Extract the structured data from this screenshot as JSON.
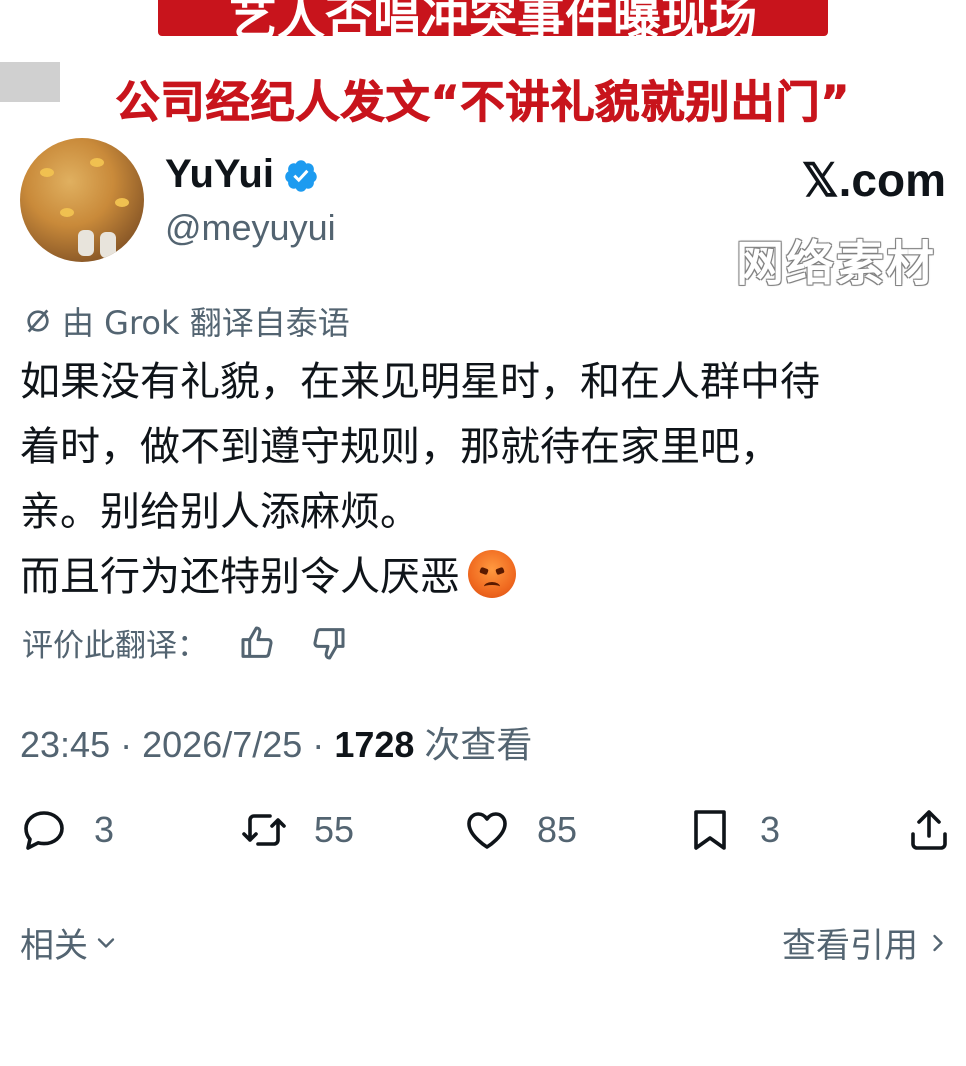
{
  "banner": {
    "text": "艺人否唱冲突事件曝现场"
  },
  "headline": {
    "text": "公司经纪人发文“不讲礼貌就别出门”"
  },
  "tweet": {
    "display_name": "YuYui",
    "handle": "@meyuyui",
    "site": "𝕏.com",
    "watermark": "网络素材",
    "translated_note": "由 Grok 翻译自泰语",
    "body_lines": [
      "如果没有礼貌，在来见明星时，和在人群中待",
      "着时，做不到遵守规则，那就待在家里吧，",
      "亲。别给别人添麻烦。",
      "而且行为还特别令人厌恶"
    ],
    "rate_label": "评价此翻译：",
    "time": "23:45",
    "date": "2026/7/25",
    "views_count": "1728",
    "views_label": "次查看",
    "sep": "·",
    "stats": {
      "replies": "3",
      "retweets": "55",
      "likes": "85",
      "bookmarks": "3"
    },
    "footer_left": "相关",
    "footer_right": "查看引用"
  },
  "icons": {
    "verified": "verified-badge-icon",
    "translate": "translate-icon",
    "thumbs_up": "thumbs-up-icon",
    "thumbs_down": "thumbs-down-icon",
    "reply": "reply-icon",
    "retweet": "retweet-icon",
    "like": "heart-icon",
    "bookmark": "bookmark-icon",
    "share": "share-icon",
    "emoji": "angry-face-emoji"
  },
  "colors": {
    "banner_red": "#c8141c",
    "verified_blue": "#1d9bf0",
    "secondary_text": "#536471"
  }
}
